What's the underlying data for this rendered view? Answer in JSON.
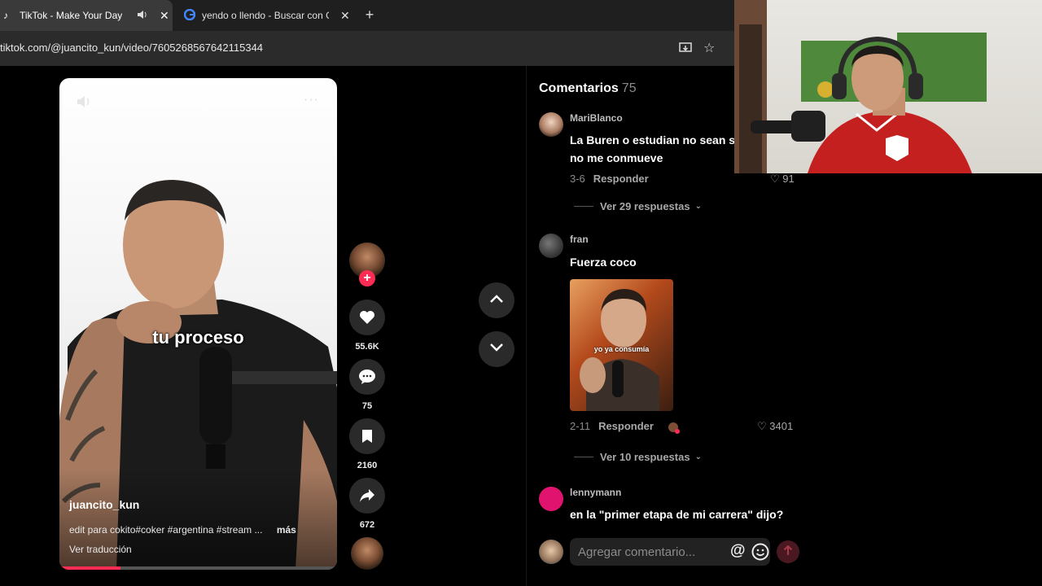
{
  "browser": {
    "tabs": [
      {
        "title": "TikTok - Make Your Day",
        "active": true
      },
      {
        "title": "yendo o llendo - Buscar con Go",
        "active": false
      }
    ],
    "url": "tiktok.com/@juancito_kun/video/7605268567642115344"
  },
  "video": {
    "caption": "tu proceso",
    "author": "juancito_kun",
    "description": "edit para cokito#coker #argentina #stream ...",
    "more_label": "más",
    "translate_label": "Ver traducción",
    "progress": 0.22
  },
  "actions": {
    "likes": "55.6K",
    "comments": "75",
    "saves": "2160",
    "shares": "672"
  },
  "comments_panel": {
    "title": "Comentarios",
    "count": "75",
    "items": [
      {
        "user": "MariBlanco",
        "text": "La Buren o estudian no sean st",
        "text2": "no me conmueve",
        "date": "3-6",
        "reply": "Responder",
        "likes": "91",
        "replies": "Ver 29 respuestas"
      },
      {
        "user": "fran",
        "text": "Fuerza coco",
        "image_caption": "yo ya consumía",
        "date": "2-11",
        "reply": "Responder",
        "likes": "3401",
        "replies": "Ver 10 respuestas"
      },
      {
        "user": "lennymann",
        "text": "en la \"primer etapa de mi carrera\" dijo?"
      }
    ],
    "input_placeholder": "Agregar comentario..."
  },
  "colors": {
    "accent": "#fe2c55",
    "background": "#000000",
    "panel": "#2a2a2a"
  }
}
